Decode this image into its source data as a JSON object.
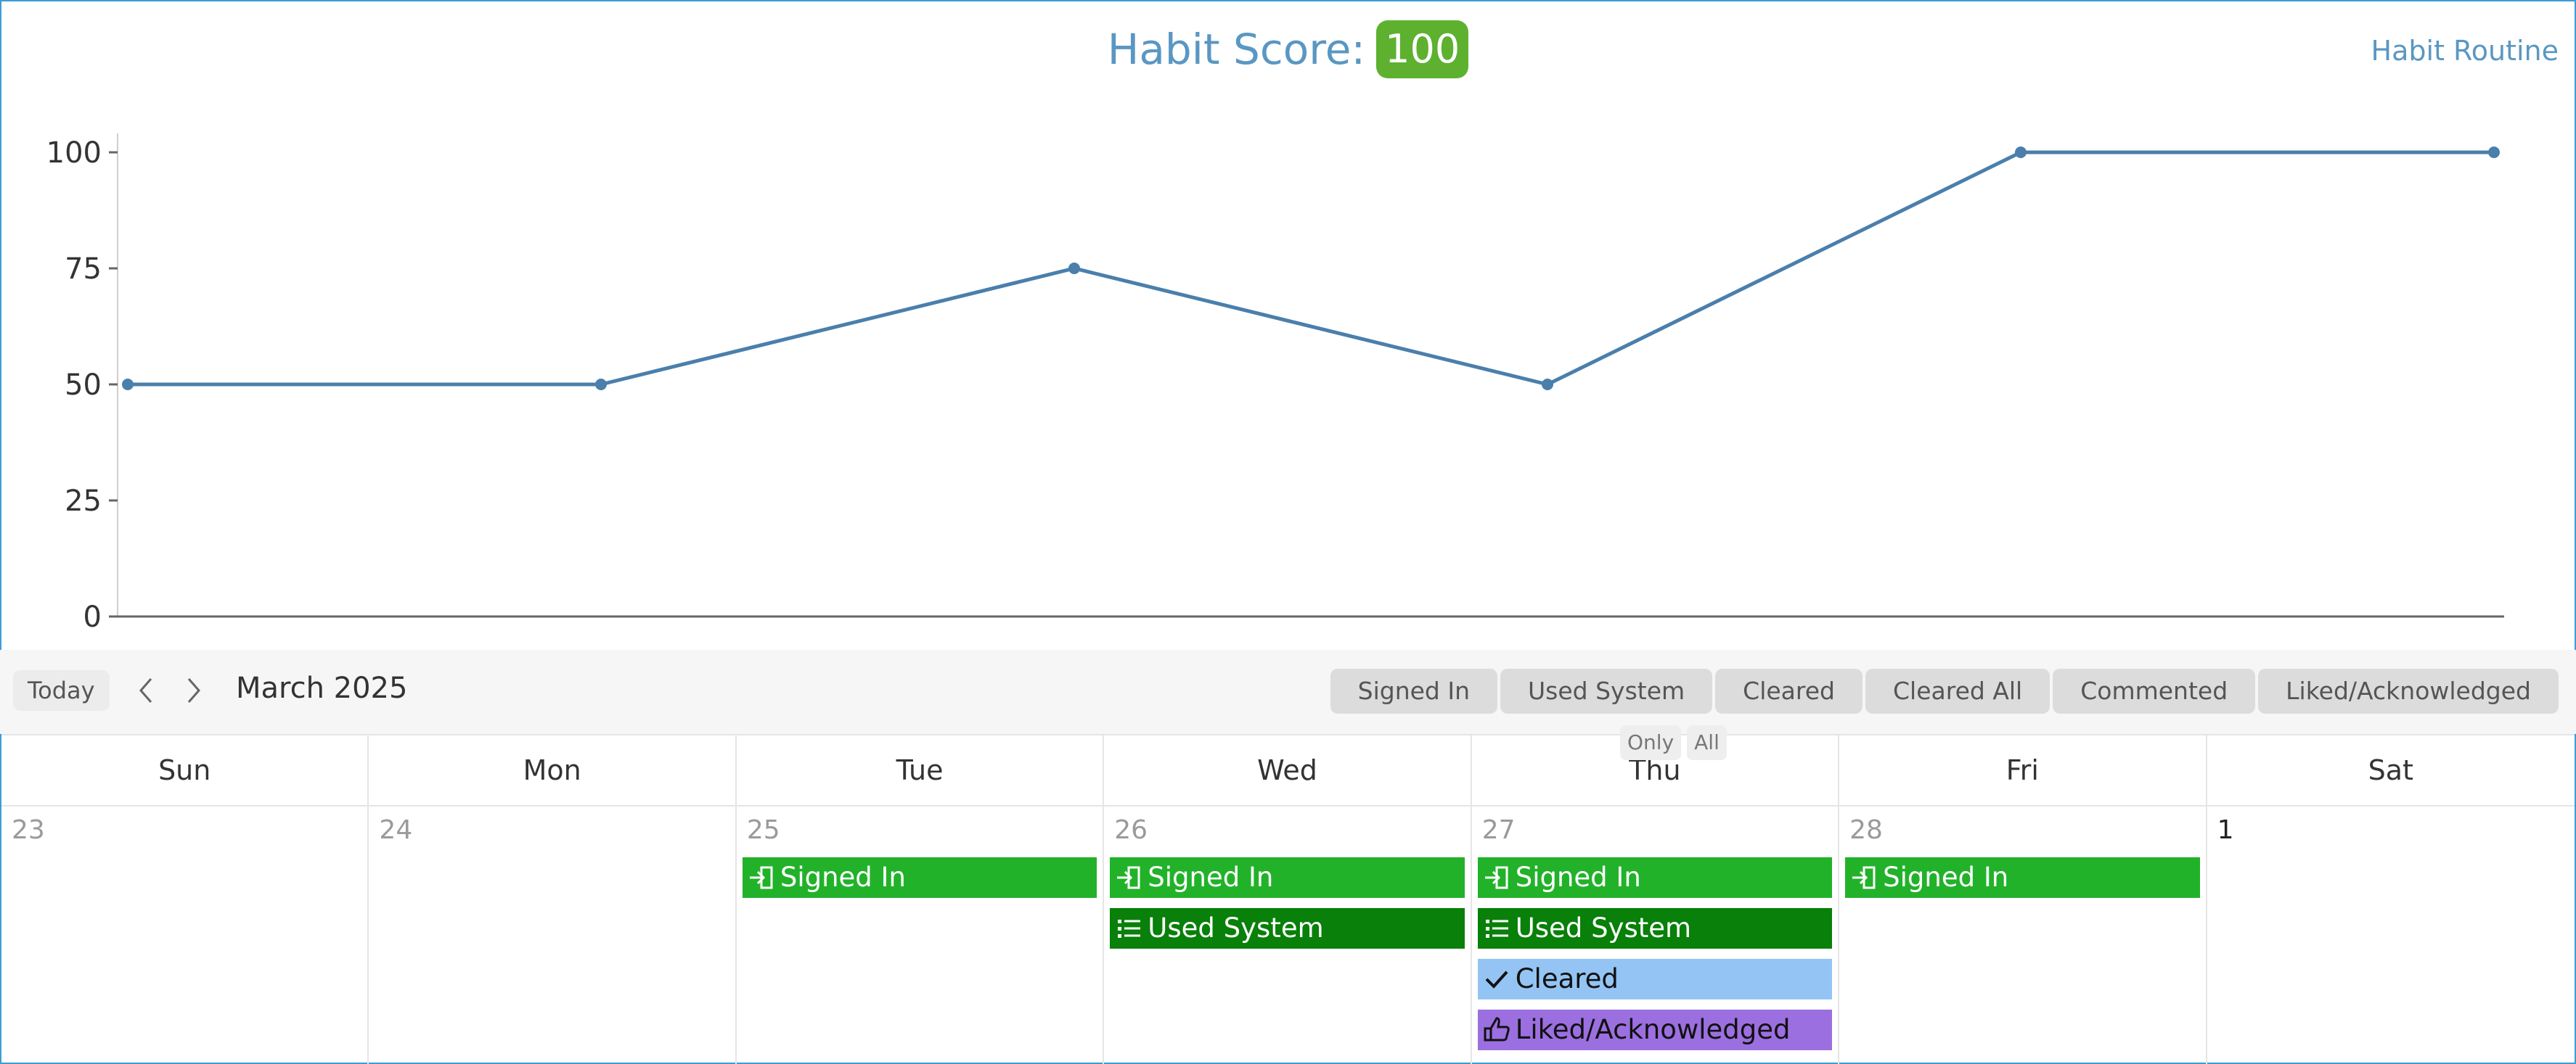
{
  "header": {
    "score_label": "Habit Score:",
    "score_value": "100",
    "routine_link": "Habit Routine"
  },
  "chart_data": {
    "type": "line",
    "x": [
      1,
      2,
      3,
      4,
      5,
      6
    ],
    "values": [
      50,
      50,
      75,
      50,
      100,
      100
    ],
    "ylim": [
      0,
      100
    ],
    "y_ticks": [
      "0",
      "25",
      "50",
      "75",
      "100"
    ],
    "line_color": "#4a7fac",
    "grid": false
  },
  "toolbar": {
    "today": "Today",
    "prev_icon": "chevron-left-icon",
    "next_icon": "chevron-right-icon",
    "month": "March 2025",
    "filters": [
      "Signed In",
      "Used System",
      "Cleared",
      "Cleared All",
      "Commented",
      "Liked/Acknowledged"
    ],
    "popover": {
      "only": "Only",
      "all": "All"
    }
  },
  "calendar": {
    "days_of_week": [
      "Sun",
      "Mon",
      "Tue",
      "Wed",
      "Thu",
      "Fri",
      "Sat"
    ],
    "dates": [
      "23",
      "24",
      "25",
      "26",
      "27",
      "28",
      "1"
    ],
    "events": {
      "signed_in": "Signed In",
      "used_system": "Used System",
      "cleared": "Cleared",
      "liked": "Liked/Acknowledged"
    }
  },
  "colors": {
    "signed_in": "#22b22a",
    "used_system": "#088009",
    "cleared": "#93c4f4",
    "liked": "#9b6fe0",
    "score_badge": "#5db12f",
    "title": "#5a97c2"
  }
}
